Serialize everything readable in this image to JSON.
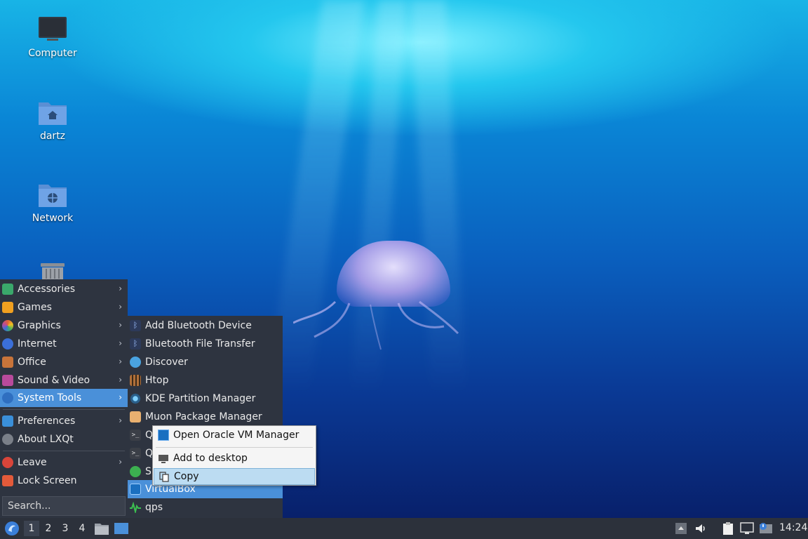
{
  "desktop": {
    "icons": [
      {
        "label": "Computer"
      },
      {
        "label": "dartz"
      },
      {
        "label": "Network"
      }
    ]
  },
  "main_menu": {
    "categories": [
      {
        "label": "Accessories",
        "icon": "accessories-icon",
        "color": "#3aa86b"
      },
      {
        "label": "Games",
        "icon": "games-icon",
        "color": "#f0a020"
      },
      {
        "label": "Graphics",
        "icon": "graphics-icon",
        "color": "#e0603a"
      },
      {
        "label": "Internet",
        "icon": "internet-icon",
        "color": "#3b6fd9"
      },
      {
        "label": "Office",
        "icon": "office-icon",
        "color": "#c8743a"
      },
      {
        "label": "Sound & Video",
        "icon": "sound-video-icon",
        "color": "#b84a9c"
      },
      {
        "label": "System Tools",
        "icon": "system-tools-icon",
        "color": "#2f6fc0"
      }
    ],
    "preferences": "Preferences",
    "about": "About LXQt",
    "leave": "Leave",
    "lock_screen": "Lock Screen",
    "search_placeholder": "Search..."
  },
  "submenu_system_tools": {
    "items": [
      {
        "label": "Add Bluetooth Device",
        "icon": "bluetooth-icon"
      },
      {
        "label": "Bluetooth File Transfer",
        "icon": "bluetooth-icon"
      },
      {
        "label": "Discover",
        "icon": "discover-icon"
      },
      {
        "label": "Htop",
        "icon": "htop-icon"
      },
      {
        "label": "KDE Partition Manager",
        "icon": "partition-manager-icon"
      },
      {
        "label": "Muon Package Manager",
        "icon": "muon-icon"
      },
      {
        "label": "Q",
        "icon": "terminal-icon"
      },
      {
        "label": "Q",
        "icon": "terminal-icon"
      },
      {
        "label": "S",
        "icon": "synaptic-icon"
      },
      {
        "label": "VirtualBox",
        "icon": "virtualbox-icon"
      },
      {
        "label": "qps",
        "icon": "qps-icon"
      }
    ]
  },
  "context_menu": {
    "open": "Open Oracle VM Manager",
    "add_desktop": "Add to desktop",
    "copy": "Copy"
  },
  "taskbar": {
    "workspaces": [
      "1",
      "2",
      "3",
      "4"
    ],
    "clock": "14:24"
  },
  "colors": {
    "menu_bg": "#2e3440",
    "highlight": "#4a90d9",
    "taskbar_bg": "#2c313b"
  }
}
